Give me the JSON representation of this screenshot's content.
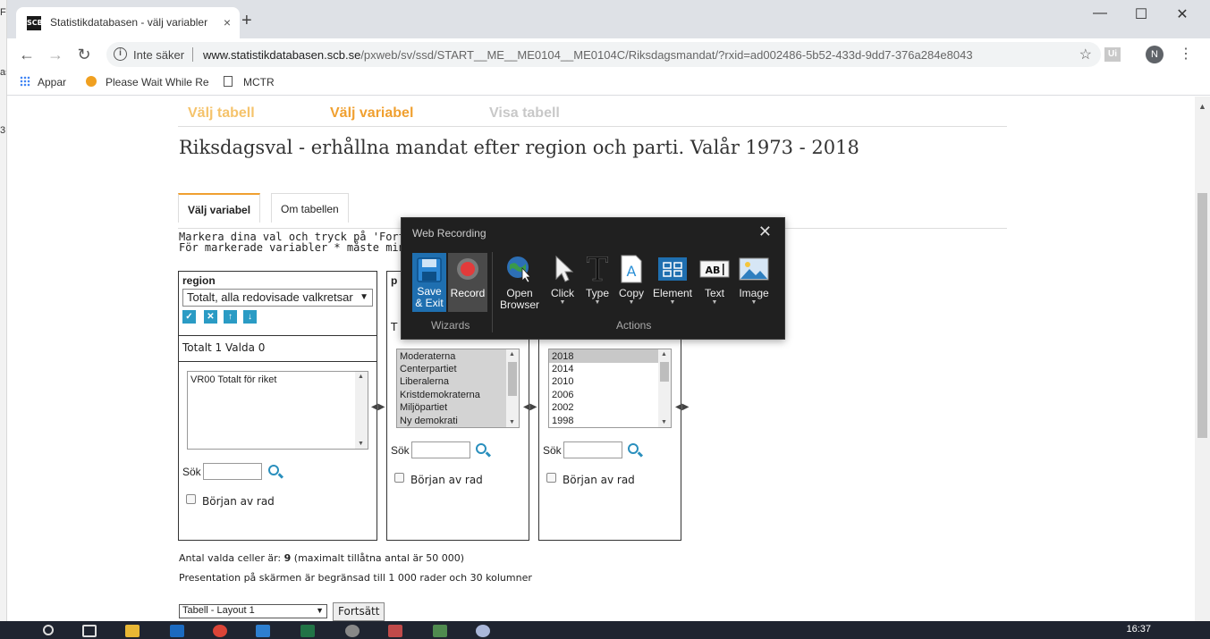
{
  "behind_window": {
    "fragments": [
      "Fi",
      "as",
      "3"
    ]
  },
  "browser": {
    "tab_title": "Statistikdatabasen - välj variabler",
    "favicon_text": "SCB",
    "tab_close": "×",
    "new_tab": "+",
    "window_controls": {
      "minimize": "—",
      "maximize": "☐",
      "close": "✕"
    },
    "nav": {
      "back": "←",
      "forward": "→",
      "reload": "↻"
    },
    "security_label": "Inte säker",
    "url_host": "www.statistikdatabasen.scb.se",
    "url_path": "/pxweb/sv/ssd/START__ME__ME0104__ME0104C/Riksdagsmandat/?rxid=ad002486-5b52-433d-9dd7-376a284e8043",
    "star": "☆",
    "profile_initial": "N",
    "menu": "⋮",
    "ext_label": "Ui",
    "bookmarks": [
      {
        "label": "Appar",
        "icon": "apps-grid-icon"
      },
      {
        "label": "Please Wait While Re",
        "icon": "orange-badge-icon"
      },
      {
        "label": "MCTR",
        "icon": "page-icon"
      }
    ]
  },
  "page": {
    "steps": [
      {
        "label": "Välj tabell",
        "color": "#f5c36b"
      },
      {
        "label": "Välj variabel",
        "color": "#f0a030"
      },
      {
        "label": "Visa tabell",
        "color": "#c8c8c8"
      }
    ],
    "heading": "Riksdagsval - erhållna mandat efter region och parti. Valår 1973 - 2018",
    "tabs": [
      "Välj variabel",
      "Om tabellen"
    ],
    "instructions": [
      "Markera dina val och tryck på 'Fortsätt'. Ti",
      "För markerade variabler * måste minst ett va"
    ],
    "region_box": {
      "title": "region",
      "select_value": "Totalt, alla redovisade valkretsar",
      "buttons": [
        "✓",
        "✕",
        "↑",
        "↓"
      ],
      "counts_label": "Totalt 1 Valda",
      "counts_value": "0",
      "items": [
        "VR00 Totalt för riket"
      ],
      "search_label": "Sök",
      "checkbox_label": "Början av rad"
    },
    "parti_box": {
      "title_fragment": "p",
      "counts_fragment": "T",
      "items": [
        "Moderaterna",
        "Centerpartiet",
        "Liberalerna",
        "Kristdemokraterna",
        "Miljöpartiet",
        "Ny demokrati"
      ],
      "search_label": "Sök",
      "checkbox_label": "Början av rad"
    },
    "year_box": {
      "items": [
        "2018",
        "2014",
        "2010",
        "2006",
        "2002",
        "1998"
      ],
      "search_label": "Sök",
      "checkbox_label": "Början av rad"
    },
    "cells_label": "Antal valda celler är:",
    "cells_value": "9",
    "cells_max": "(maximalt tillåtna antal är 50 000)",
    "presentation_note": "Presentation på skärmen är begränsad till 1 000 rader och 30 kolumner",
    "layout_select": "Tabell - Layout 1",
    "continue_button": "Fortsätt"
  },
  "web_recording": {
    "title": "Web Recording",
    "close": "✕",
    "tools": [
      {
        "label": "Save & Exit",
        "icon": "floppy-disk-icon"
      },
      {
        "label": "Record",
        "icon": "record-icon"
      },
      {
        "label": "Open Browser",
        "icon": "globe-cursor-icon"
      },
      {
        "label": "Click",
        "icon": "cursor-icon"
      },
      {
        "label": "Type",
        "icon": "type-t-icon"
      },
      {
        "label": "Copy",
        "icon": "document-a-icon"
      },
      {
        "label": "Element",
        "icon": "element-grid-icon"
      },
      {
        "label": "Text",
        "icon": "text-abi-icon"
      },
      {
        "label": "Image",
        "icon": "picture-icon"
      }
    ],
    "group_wizards": "Wizards",
    "group_actions": "Actions"
  },
  "taskbar": {
    "time": "16:37"
  }
}
